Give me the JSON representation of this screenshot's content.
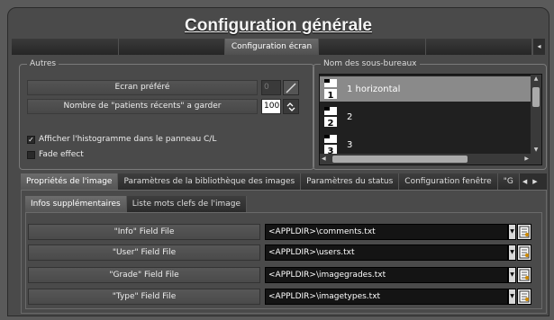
{
  "title": "Configuration générale",
  "top_tabs": {
    "active": "Configuration écran",
    "nav_left": "◂"
  },
  "autres": {
    "legend": "Autres",
    "ecran_label": "Ecran préféré",
    "ecran_value": "0",
    "patients_label": "Nombre de \"patients récents\" a garder",
    "patients_value": "100",
    "histogramme_label": "Afficher l'histogramme dans le panneau C/L",
    "histogramme_checked": true,
    "fade_label": "Fade effect",
    "fade_checked": false
  },
  "sous_bureaux": {
    "legend": "Nom des sous-bureaux",
    "items": [
      {
        "num": "1",
        "label": "1 horizontal",
        "selected": true
      },
      {
        "num": "2",
        "label": "2",
        "selected": false
      },
      {
        "num": "3",
        "label": "3",
        "selected": false
      }
    ]
  },
  "main_tabs": [
    {
      "label": "Propriétés de l'image",
      "active": true
    },
    {
      "label": "Paramètres de la bibliothèque des images",
      "active": false
    },
    {
      "label": "Paramètres du status",
      "active": false
    },
    {
      "label": "Configuration fenêtre",
      "active": false
    },
    {
      "label": "\"G",
      "active": false
    }
  ],
  "sub_tabs": [
    {
      "label": "Infos supplémentaires",
      "active": true
    },
    {
      "label": "Liste mots clefs de l'image",
      "active": false
    }
  ],
  "fields": [
    {
      "label": "\"Info\" Field File",
      "value": "<APPLDIR>\\comments.txt"
    },
    {
      "label": "\"User\" Field File",
      "value": "<APPLDIR>\\users.txt"
    },
    {
      "label": "\"Grade\" Field File",
      "value": "<APPLDIR>\\imagegrades.txt"
    },
    {
      "label": "\"Type\" Field File",
      "value": "<APPLDIR>\\imagetypes.txt"
    }
  ]
}
